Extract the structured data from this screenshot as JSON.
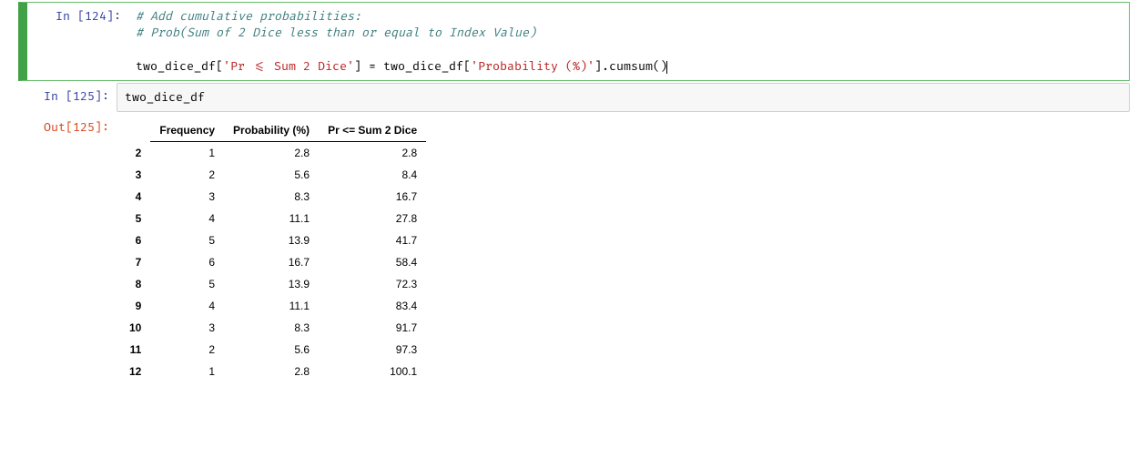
{
  "cells": {
    "c1": {
      "prompt": "In [124]:",
      "code_comment1": "# Add cumulative probabilities:",
      "code_comment2": "# Prob(Sum of 2 Dice less than or equal to Index Value)",
      "code_pre": "two_dice_df[",
      "code_str1": "'Pr <= Sum 2 Dice'",
      "code_mid": "] = two_dice_df[",
      "code_str2": "'Probability (%)'",
      "code_post": "].cumsum()"
    },
    "c2": {
      "prompt": "In [125]:",
      "code": "two_dice_df"
    },
    "c3": {
      "prompt": "Out[125]:"
    }
  },
  "table": {
    "columns": [
      "",
      "Frequency",
      "Probability (%)",
      "Pr <= Sum 2 Dice"
    ],
    "rows": [
      {
        "idx": "2",
        "freq": "1",
        "prob": "2.8",
        "cum": "2.8"
      },
      {
        "idx": "3",
        "freq": "2",
        "prob": "5.6",
        "cum": "8.4"
      },
      {
        "idx": "4",
        "freq": "3",
        "prob": "8.3",
        "cum": "16.7"
      },
      {
        "idx": "5",
        "freq": "4",
        "prob": "11.1",
        "cum": "27.8"
      },
      {
        "idx": "6",
        "freq": "5",
        "prob": "13.9",
        "cum": "41.7"
      },
      {
        "idx": "7",
        "freq": "6",
        "prob": "16.7",
        "cum": "58.4"
      },
      {
        "idx": "8",
        "freq": "5",
        "prob": "13.9",
        "cum": "72.3"
      },
      {
        "idx": "9",
        "freq": "4",
        "prob": "11.1",
        "cum": "83.4"
      },
      {
        "idx": "10",
        "freq": "3",
        "prob": "8.3",
        "cum": "91.7"
      },
      {
        "idx": "11",
        "freq": "2",
        "prob": "5.6",
        "cum": "97.3"
      },
      {
        "idx": "12",
        "freq": "1",
        "prob": "2.8",
        "cum": "100.1"
      }
    ]
  }
}
